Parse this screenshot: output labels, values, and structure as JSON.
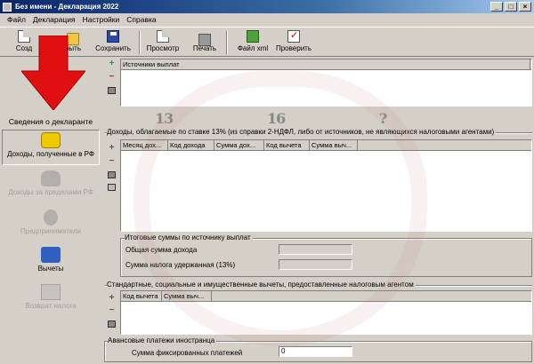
{
  "window": {
    "title": "Без имени - Декларация 2022",
    "min": "_",
    "max": "□",
    "close": "×"
  },
  "menu": [
    "Файл",
    "Декларация",
    "Настройки",
    "Справка"
  ],
  "toolbar": {
    "create": "Созд",
    "open": "рыть",
    "save": "Сохранить",
    "preview": "Просмотр",
    "print": "Печать",
    "xml": "Файл xml",
    "check": "Проверить"
  },
  "sidebar": {
    "heading": "Сведения о декларанте",
    "items": [
      {
        "label": "Доходы, полученные в РФ",
        "icon": "coins-icon"
      },
      {
        "label": "Доходы за пределами РФ",
        "icon": "money-bag-icon"
      },
      {
        "label": "Предприниматели",
        "icon": "gears-icon"
      },
      {
        "label": "Вычеты",
        "icon": "person-icon"
      },
      {
        "label": "Возврат налога",
        "icon": "document-icon"
      }
    ]
  },
  "sources": {
    "column": "Источники выплат"
  },
  "annotations": {
    "a": "13",
    "b": "16",
    "c": "?"
  },
  "income": {
    "title": "Доходы, облагаемые по ставке 13% (из справки 2-НДФЛ, либо от источников, не являющихся налоговыми агентами)",
    "columns": [
      "Месяц дох...",
      "Код дохода",
      "Сумма дох...",
      "Код вычета",
      "Сумма выч..."
    ]
  },
  "totals": {
    "title": "Итоговые суммы по источнику выплат",
    "total_income_label": "Общая сумма дохода",
    "tax_withheld_label": "Сумма налога удержанная (13%)"
  },
  "deductions": {
    "title": "Стандартные, социальные и имущественные вычеты, предоставленные налоговым агентом",
    "columns": [
      "Код вычета",
      "Сумма выч..."
    ]
  },
  "advance": {
    "title": "Авансовые платежи иностранца",
    "fixed_label": "Сумма фиксированных платежей",
    "fixed_value": "0"
  },
  "colors": {
    "arrow": "#e01010",
    "accent": "#0a246a"
  }
}
